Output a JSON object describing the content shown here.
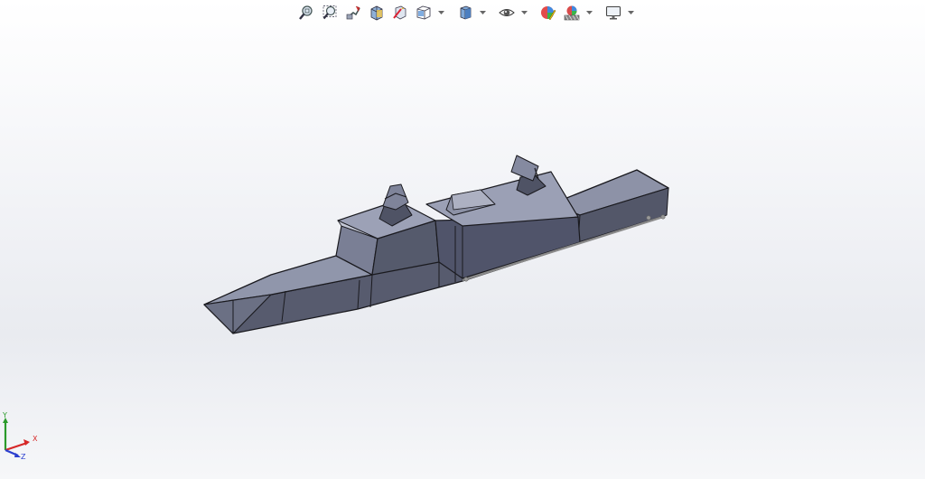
{
  "toolbar": {
    "items": [
      {
        "icon": "zoom-to-fit-icon",
        "dropdown": false
      },
      {
        "icon": "zoom-to-area-icon",
        "dropdown": false
      },
      {
        "icon": "previous-view-icon",
        "dropdown": false
      },
      {
        "icon": "section-view-icon",
        "dropdown": false
      },
      {
        "icon": "dynamic-annotation-views-icon",
        "dropdown": false
      },
      {
        "icon": "view-orientation-icon",
        "dropdown": true
      },
      {
        "icon": "display-style-icon",
        "dropdown": true
      },
      {
        "icon": "hide-show-items-icon",
        "dropdown": true
      },
      {
        "icon": "edit-appearance-icon",
        "dropdown": false
      },
      {
        "icon": "apply-scene-icon",
        "dropdown": true
      },
      {
        "icon": "view-settings-icon",
        "dropdown": true
      }
    ]
  },
  "triad": {
    "y_label": "Y",
    "x_label": "X",
    "z_label": "Z",
    "y_color": "#2a9a2a",
    "x_color": "#d62828",
    "z_color": "#2b3fcf"
  },
  "model": {
    "body_color": "#565a6c",
    "top_color": "#8e93a8",
    "edge_color": "#1a1a1f"
  }
}
